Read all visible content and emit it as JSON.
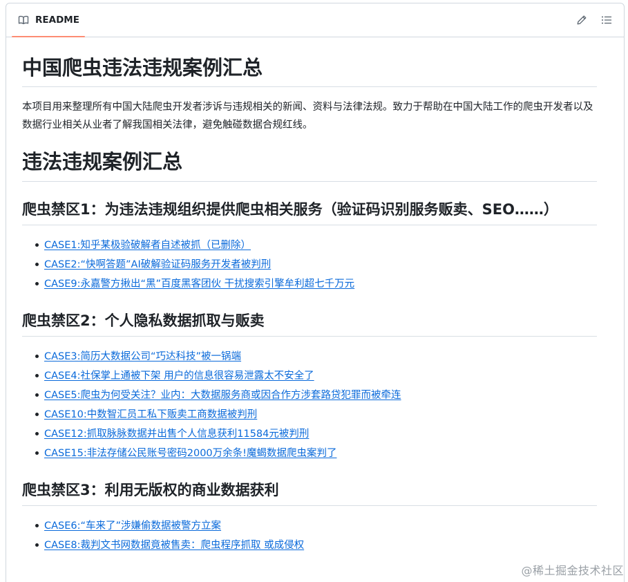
{
  "header": {
    "tab_label": "README",
    "tab_icon": "book-icon",
    "edit_icon": "pencil-icon",
    "outline_icon": "list-icon"
  },
  "readme": {
    "title": "中国爬虫违法违规案例汇总",
    "intro": "本项目用来整理所有中国大陆爬虫开发者涉诉与违规相关的新闻、资料与法律法规。致力于帮助在中国大陆工作的爬虫开发者以及数据行业相关从业者了解我国相关法律，避免触碰数据合规红线。",
    "section_title": "违法违规案例汇总",
    "zones": [
      {
        "title": "爬虫禁区1：为违法违规组织提供爬虫相关服务（验证码识别服务贩卖、SEO……）",
        "cases": [
          "CASE1:知乎某极验破解者自述被抓（已删除）",
          "CASE2:“快啊答题”AI破解验证码服务开发者被判刑",
          "CASE9:永嘉警方揪出“黑”百度黑客团伙 干扰搜索引擎牟利超七千万元"
        ]
      },
      {
        "title": "爬虫禁区2：个人隐私数据抓取与贩卖",
        "cases": [
          "CASE3:简历大数据公司“巧达科技”被一锅端",
          "CASE4:社保掌上通被下架 用户的信息很容易泄露太不安全了",
          "CASE5:爬虫为何受关注？业内：大数据服务商或因合作方涉套路贷犯罪而被牵连",
          "CASE10:中数智汇员工私下贩卖工商数据被判刑",
          "CASE12:抓取脉脉数据并出售个人信息获利11584元被判刑",
          "CASE15:非法存储公民账号密码2000万余条!魔蝎数据爬虫案判了"
        ]
      },
      {
        "title": "爬虫禁区3：利用无版权的商业数据获利",
        "cases": [
          "CASE6:“车来了”涉嫌偷数据被警方立案",
          "CASE8:裁判文书网数据竟被售卖：爬虫程序抓取 或成侵权"
        ]
      }
    ]
  },
  "watermark": "@稀土掘金技术社区"
}
